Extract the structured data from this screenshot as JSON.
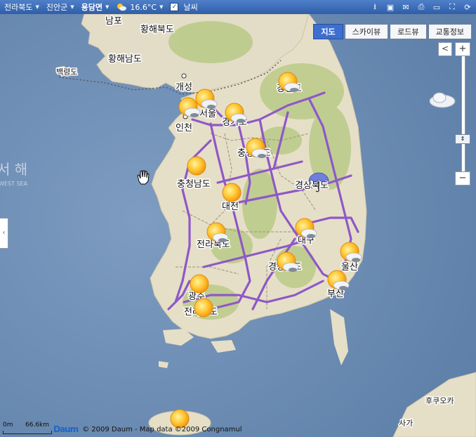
{
  "topbar": {
    "breadcrumbs": [
      "전라북도",
      "진안군",
      "용담면"
    ],
    "weather_temp": "16.6°C",
    "weather_checkbox_label": "날씨",
    "icons": [
      "download-icon",
      "save-icon",
      "mail-icon",
      "print-icon",
      "ruler-icon",
      "fullscreen-icon",
      "refresh-icon"
    ]
  },
  "map_types": [
    {
      "label": "지도",
      "active": true
    },
    {
      "label": "스카이뷰",
      "active": false
    },
    {
      "label": "로드뷰",
      "active": false
    },
    {
      "label": "교통정보",
      "active": false
    }
  ],
  "zoom": {
    "plus": "+",
    "minus": "−",
    "prev": "<",
    "level_fraction": 0.72
  },
  "side_tab": "‹",
  "map": {
    "sea_label": "서 해",
    "sea_label_en": "WEST SEA",
    "labels": [
      {
        "id": "nampo",
        "text": "남포"
      },
      {
        "id": "hwanghae-north",
        "text": "황해북도"
      },
      {
        "id": "hwanghae-south",
        "text": "황해남도"
      },
      {
        "id": "baengnyeong",
        "text": "백령도"
      },
      {
        "id": "kaesong",
        "text": "개성"
      },
      {
        "id": "seoul",
        "text": "서울"
      },
      {
        "id": "incheon",
        "text": "인천"
      },
      {
        "id": "gangwon",
        "text": "강원도"
      },
      {
        "id": "gyeonggi",
        "text": "경기도"
      },
      {
        "id": "chungbuk",
        "text": "충청북도"
      },
      {
        "id": "chungnam",
        "text": "충청남도"
      },
      {
        "id": "daejeon",
        "text": "대전"
      },
      {
        "id": "gyeongbuk",
        "text": "경상북도"
      },
      {
        "id": "jeonbuk",
        "text": "전라북도"
      },
      {
        "id": "daegu",
        "text": "대구"
      },
      {
        "id": "ulsan",
        "text": "울산"
      },
      {
        "id": "gyeongnam",
        "text": "경상남도"
      },
      {
        "id": "busan",
        "text": "부산"
      },
      {
        "id": "gwangju",
        "text": "광주"
      },
      {
        "id": "jeonnam",
        "text": "전라남도"
      },
      {
        "id": "fukuoka",
        "text": "후쿠오카"
      },
      {
        "id": "saga",
        "text": "사가"
      }
    ],
    "weather": [
      {
        "place": "gangwon",
        "kind": "partly-cloudy-sun"
      },
      {
        "place": "seoul",
        "kind": "partly-cloudy-sun"
      },
      {
        "place": "incheon",
        "kind": "partly-cloudy-sun"
      },
      {
        "place": "gyeonggi",
        "kind": "partly-cloudy-sun"
      },
      {
        "place": "chungbuk",
        "kind": "partly-cloudy-sun"
      },
      {
        "place": "chungnam",
        "kind": "sunny"
      },
      {
        "place": "daejeon",
        "kind": "sunny"
      },
      {
        "place": "gyeongbuk",
        "kind": "rain-umbrella"
      },
      {
        "place": "jeonbuk",
        "kind": "partly-cloudy-sun"
      },
      {
        "place": "daegu",
        "kind": "partly-cloudy-sun"
      },
      {
        "place": "ulsan",
        "kind": "partly-cloudy-sun"
      },
      {
        "place": "gyeongnam",
        "kind": "partly-cloudy-sun"
      },
      {
        "place": "busan",
        "kind": "partly-cloudy-sun"
      },
      {
        "place": "gwangju",
        "kind": "sunny"
      },
      {
        "place": "jeonnam",
        "kind": "sunny"
      },
      {
        "place": "jeju",
        "kind": "sunny"
      },
      {
        "place": "ulleung",
        "kind": "cloudy"
      }
    ]
  },
  "scale": {
    "start": "0m",
    "end": "66.6km"
  },
  "copyright": {
    "logo": "Daum",
    "text": "© 2009 Daum - Map data ©2009 Congnamul"
  },
  "colors": {
    "sea": "#6f8fb4",
    "land": "#e6ddc6",
    "highway": "#8f59c9",
    "topbar": "#3b6cb8",
    "active_button": "#3d6fd0"
  }
}
